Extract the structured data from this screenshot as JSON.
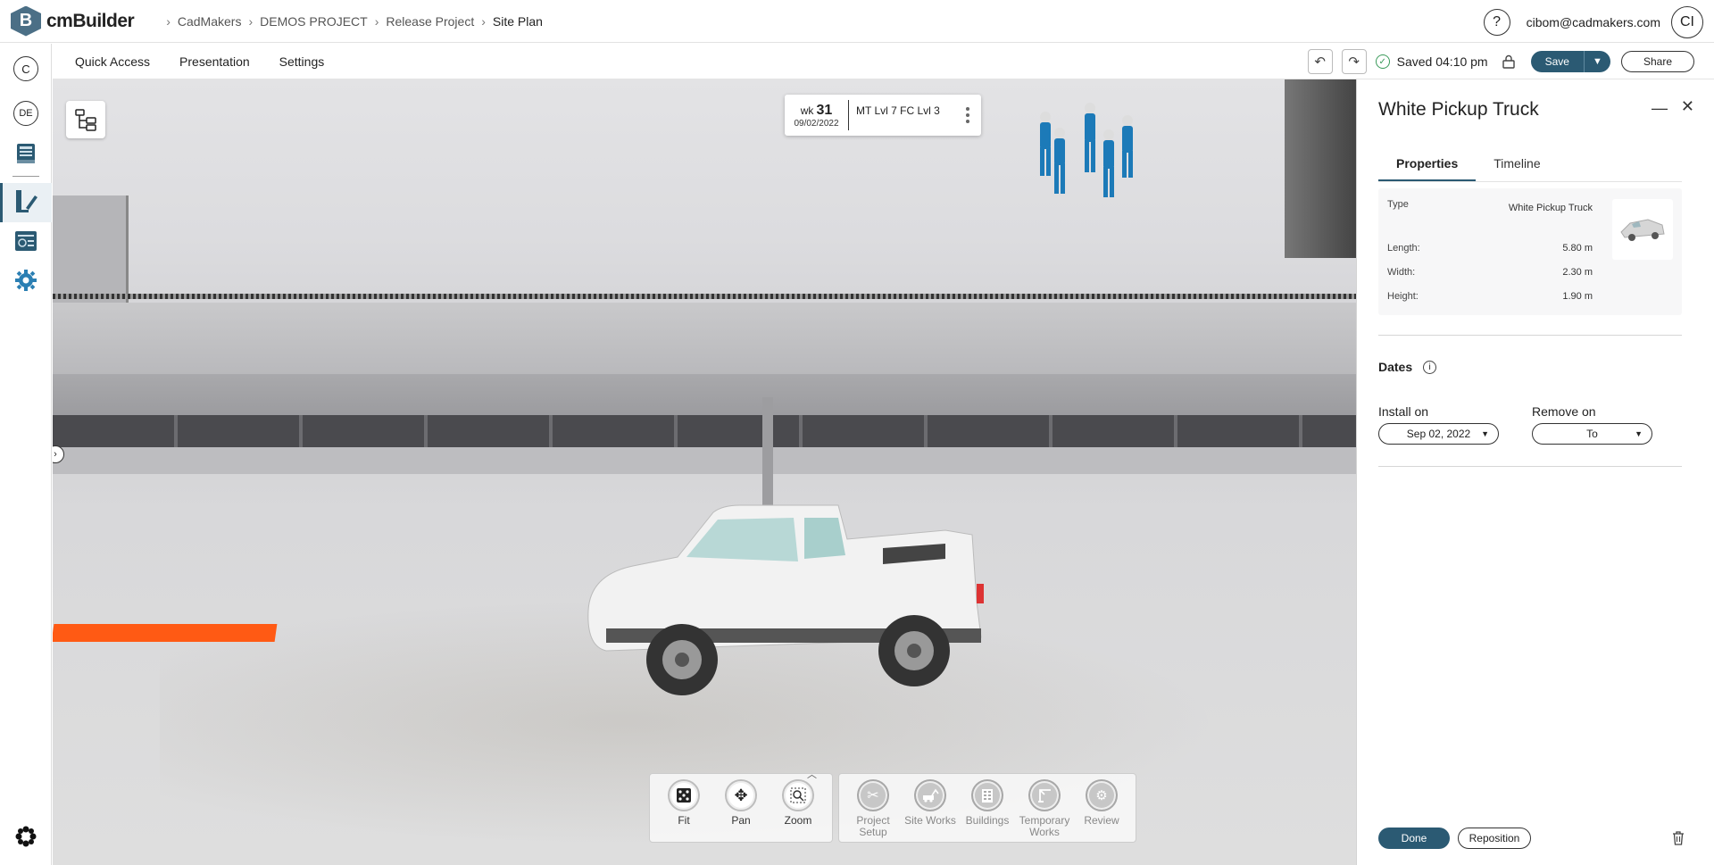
{
  "app": {
    "logo_letter": "B",
    "name": "cmBuilder"
  },
  "breadcrumb": [
    "CadMakers",
    "DEMOS PROJECT",
    "Release Project",
    "Site Plan"
  ],
  "header": {
    "help_label": "?",
    "user_email": "cibom@cadmakers.com",
    "avatar_initials": "CI"
  },
  "sidebar": {
    "org_initial": "C",
    "project_initials": "DE"
  },
  "toolbar": {
    "menu": [
      "Quick Access",
      "Presentation",
      "Settings"
    ],
    "saved_status": "Saved 04:10 pm",
    "save_label": "Save",
    "share_label": "Share"
  },
  "week_card": {
    "wk_prefix": "wk",
    "wk_number": "31",
    "date": "09/02/2022",
    "label": "MT Lvl 7 FC Lvl 3"
  },
  "palette": {
    "view_tools": [
      {
        "label": "Fit",
        "icon": "fit-icon"
      },
      {
        "label": "Pan",
        "icon": "pan-icon"
      },
      {
        "label": "Zoom",
        "icon": "zoom-icon"
      }
    ],
    "categories": [
      {
        "label": "Project\nSetup",
        "icon": "tools-icon"
      },
      {
        "label": "Site Works",
        "icon": "excavator-icon"
      },
      {
        "label": "Buildings",
        "icon": "building-icon"
      },
      {
        "label": "Temporary\nWorks",
        "icon": "crane-icon"
      },
      {
        "label": "Review",
        "icon": "review-icon"
      }
    ]
  },
  "panel": {
    "title": "White Pickup Truck",
    "tabs": [
      "Properties",
      "Timeline"
    ],
    "active_tab": "Properties",
    "properties": {
      "type_label": "Type",
      "type_value": "White Pickup Truck",
      "length_label": "Length:",
      "length_value": "5.80 m",
      "width_label": "Width:",
      "width_value": "2.30 m",
      "height_label": "Height:",
      "height_value": "1.90 m"
    },
    "dates": {
      "title": "Dates",
      "install_label": "Install on",
      "install_value": "Sep 02, 2022",
      "remove_label": "Remove on",
      "remove_value": "To"
    },
    "done_label": "Done",
    "reposition_label": "Reposition"
  },
  "colors": {
    "primary": "#2b5a73",
    "accent_orange": "#ff5a14",
    "success": "#3a9a5a"
  }
}
